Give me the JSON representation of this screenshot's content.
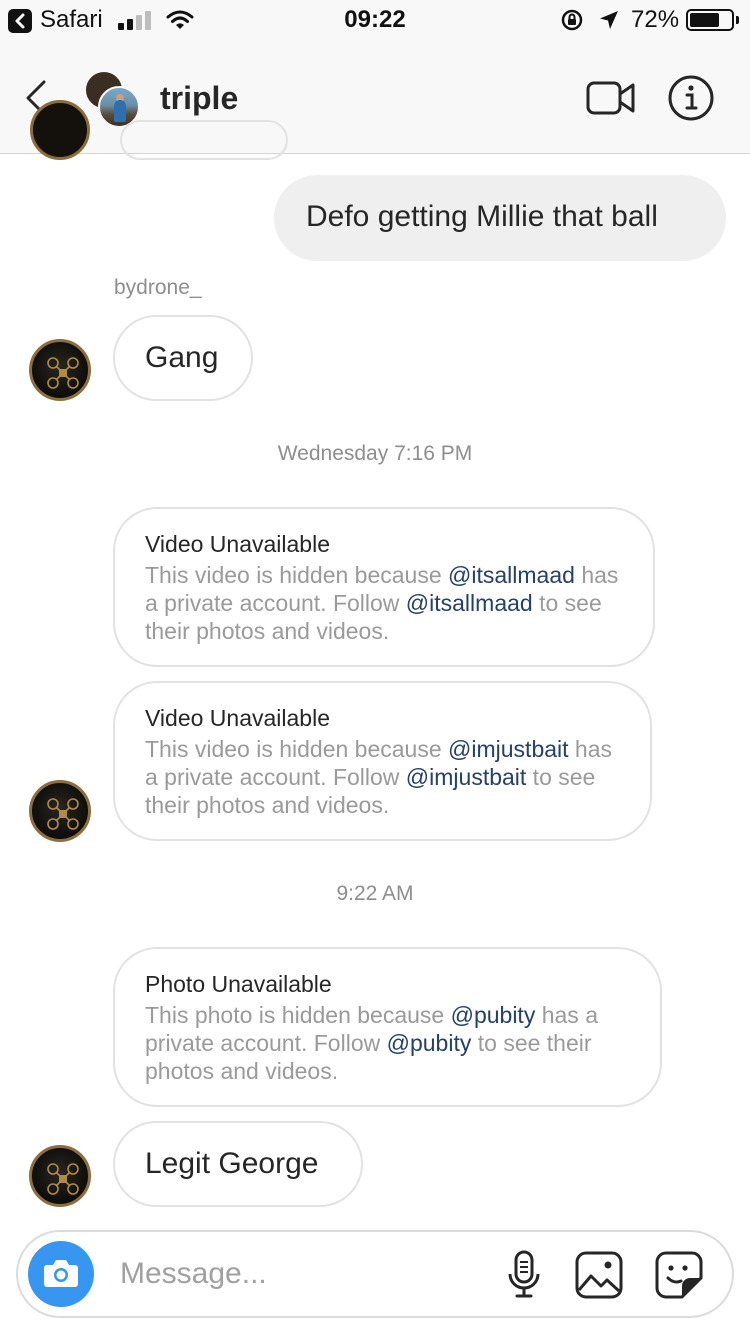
{
  "status_bar": {
    "back_app": "Safari",
    "time": "09:22",
    "battery_percent": "72%",
    "battery_level": 0.72
  },
  "header": {
    "title": "triple"
  },
  "messages": {
    "outgoing_1": "Defo getting Millie that ball",
    "sender_name": "bydrone_",
    "incoming_1": "Gang",
    "time_1": "Wednesday 7:16 PM",
    "card_1": {
      "title": "Video Unavailable",
      "pre": "This video is hidden because ",
      "mention_a": "@itsallmaad",
      "mid": " has a private account. Follow ",
      "mention_b": "@itsallmaad",
      "post": " to see their photos and videos."
    },
    "card_2": {
      "title": "Video Unavailable",
      "pre": "This video is hidden because ",
      "mention_a": "@imjustbait",
      "mid": " has a private account. Follow ",
      "mention_b": "@imjustbait",
      "post": " to see their photos and videos."
    },
    "time_2": "9:22 AM",
    "card_3": {
      "title": "Photo Unavailable",
      "pre": "This photo is hidden because ",
      "mention_a": "@pubity",
      "mid": " has a private account. Follow ",
      "mention_b": "@pubity",
      "post": " to see their photos and videos."
    },
    "incoming_2": "Legit George"
  },
  "composer": {
    "placeholder": "Message..."
  },
  "icons": {
    "back": "chevron-left-icon",
    "video_call": "video-camera-icon",
    "info": "info-icon",
    "camera": "camera-icon",
    "mic": "microphone-icon",
    "gallery": "image-icon",
    "sticker": "sticker-icon"
  },
  "colors": {
    "accent_blue": "#3797f0",
    "mention": "#24406b",
    "outgoing_bubble": "#efefef",
    "muted_text": "#8e8e8e"
  }
}
